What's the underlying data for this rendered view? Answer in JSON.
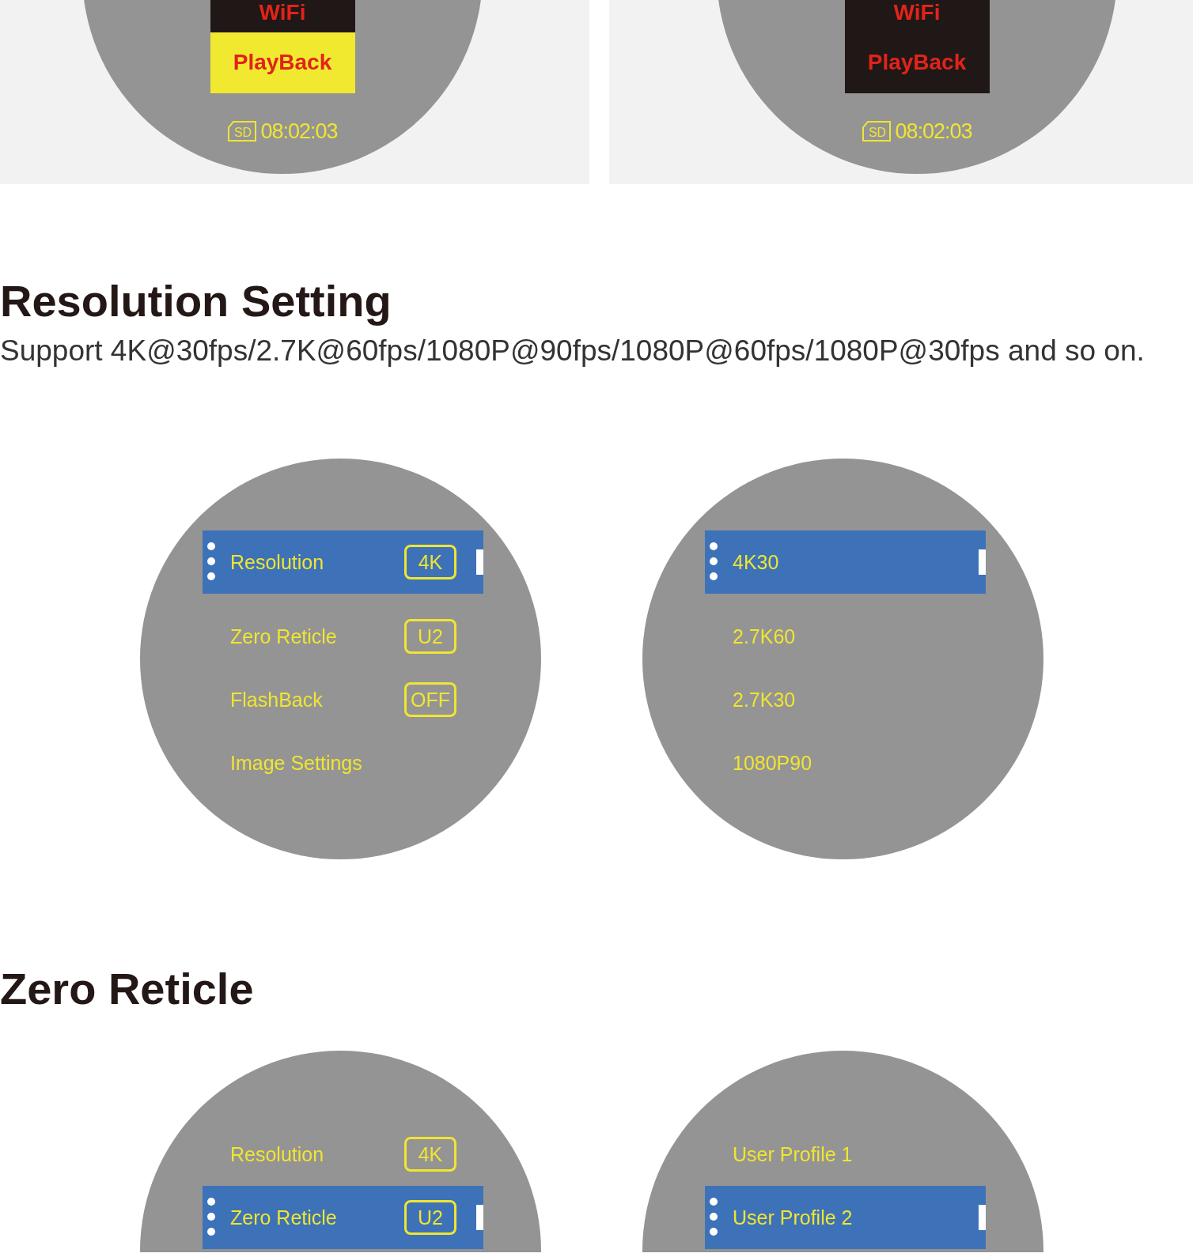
{
  "top_screens": [
    {
      "menu": [
        {
          "label": "WiFi",
          "selected": false
        },
        {
          "label": "PlayBack",
          "selected": true
        }
      ],
      "storage": "SD",
      "time": "08:02:03"
    },
    {
      "menu": [
        {
          "label": "WiFi",
          "selected": false
        },
        {
          "label": "PlayBack",
          "selected": false
        }
      ],
      "storage": "SD",
      "time": "08:02:03"
    }
  ],
  "sections": [
    {
      "title": "Resolution Setting",
      "description": "Support 4K@30fps/2.7K@60fps/1080P@90fps/1080P@60fps/1080P@30fps and so on.",
      "screens": [
        {
          "items": [
            {
              "label": "Resolution",
              "value": "4K",
              "selected": true
            },
            {
              "label": "Zero Reticle",
              "value": "U2",
              "selected": false
            },
            {
              "label": "FlashBack",
              "value": "OFF",
              "selected": false
            },
            {
              "label": "Image Settings",
              "selected": false
            }
          ]
        },
        {
          "items": [
            {
              "label": "4K30",
              "selected": true
            },
            {
              "label": "2.7K60",
              "selected": false
            },
            {
              "label": "2.7K30",
              "selected": false
            },
            {
              "label": "1080P90",
              "selected": false
            }
          ]
        }
      ]
    },
    {
      "title": "Zero Reticle",
      "screens": [
        {
          "items": [
            {
              "label": "Resolution",
              "value": "4K",
              "selected": false
            },
            {
              "label": "Zero Reticle",
              "value": "U2",
              "selected": true
            }
          ]
        },
        {
          "items": [
            {
              "label": "User Profile 1",
              "selected": false
            },
            {
              "label": "User Profile 2",
              "selected": true
            }
          ]
        }
      ]
    }
  ]
}
